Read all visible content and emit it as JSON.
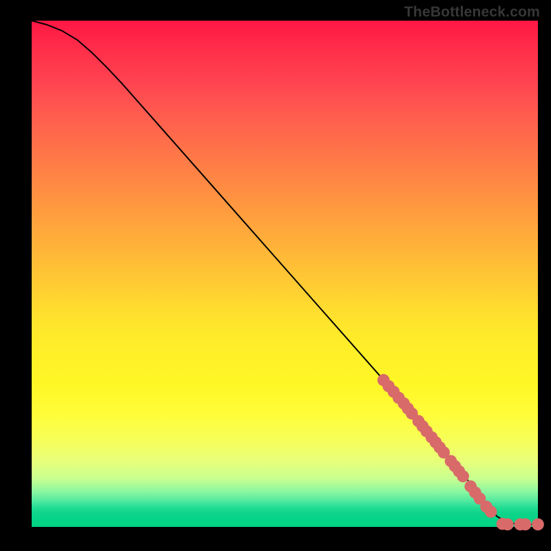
{
  "attribution": "TheBottleneck.com",
  "colors": {
    "point": "#d86a6a",
    "line": "#000000",
    "gradient_top": "#ff1744",
    "gradient_bottom": "#00d485"
  },
  "chart_data": {
    "type": "line",
    "title": "",
    "xlabel": "",
    "ylabel": "",
    "xlim": [
      0,
      100
    ],
    "ylim": [
      0,
      100
    ],
    "grid": false,
    "legend": false,
    "series": [
      {
        "name": "curve",
        "x": [
          0,
          3,
          6,
          9,
          12,
          15,
          18,
          21,
          24,
          27,
          30,
          33,
          36,
          39,
          42,
          45,
          48,
          51,
          54,
          57,
          60,
          63,
          66,
          69,
          72,
          75,
          78,
          80,
          82,
          84,
          86,
          88,
          90,
          92,
          94,
          96,
          98,
          100
        ],
        "y": [
          100,
          99.2,
          98.0,
          96.2,
          93.6,
          90.6,
          87.4,
          84.0,
          80.6,
          77.2,
          73.8,
          70.4,
          67.0,
          63.6,
          60.2,
          56.8,
          53.4,
          50.0,
          46.6,
          43.2,
          39.8,
          36.4,
          33.0,
          29.6,
          26.2,
          22.8,
          19.4,
          17.0,
          14.6,
          12.0,
          9.4,
          6.8,
          4.2,
          2.0,
          0.9,
          0.5,
          0.5,
          0.5
        ]
      }
    ],
    "points": [
      {
        "x": 69.5,
        "y": 29.0
      },
      {
        "x": 70.5,
        "y": 27.8
      },
      {
        "x": 71.5,
        "y": 26.7
      },
      {
        "x": 72.5,
        "y": 25.5
      },
      {
        "x": 73.5,
        "y": 24.4
      },
      {
        "x": 74.3,
        "y": 23.4
      },
      {
        "x": 75.1,
        "y": 22.4
      },
      {
        "x": 76.4,
        "y": 20.9
      },
      {
        "x": 77.2,
        "y": 19.9
      },
      {
        "x": 78.0,
        "y": 18.9
      },
      {
        "x": 79.0,
        "y": 17.7
      },
      {
        "x": 79.8,
        "y": 16.7
      },
      {
        "x": 80.6,
        "y": 15.7
      },
      {
        "x": 81.4,
        "y": 14.7
      },
      {
        "x": 82.8,
        "y": 13.0
      },
      {
        "x": 83.6,
        "y": 12.0
      },
      {
        "x": 84.4,
        "y": 11.0
      },
      {
        "x": 85.2,
        "y": 10.0
      },
      {
        "x": 86.7,
        "y": 8.0
      },
      {
        "x": 87.6,
        "y": 6.8
      },
      {
        "x": 88.5,
        "y": 5.6
      },
      {
        "x": 89.8,
        "y": 4.0
      },
      {
        "x": 90.7,
        "y": 3.0
      },
      {
        "x": 93.0,
        "y": 0.6
      },
      {
        "x": 94.0,
        "y": 0.5
      },
      {
        "x": 96.5,
        "y": 0.5
      },
      {
        "x": 97.5,
        "y": 0.5
      },
      {
        "x": 100.0,
        "y": 0.5
      }
    ],
    "point_radius": 1.2
  }
}
